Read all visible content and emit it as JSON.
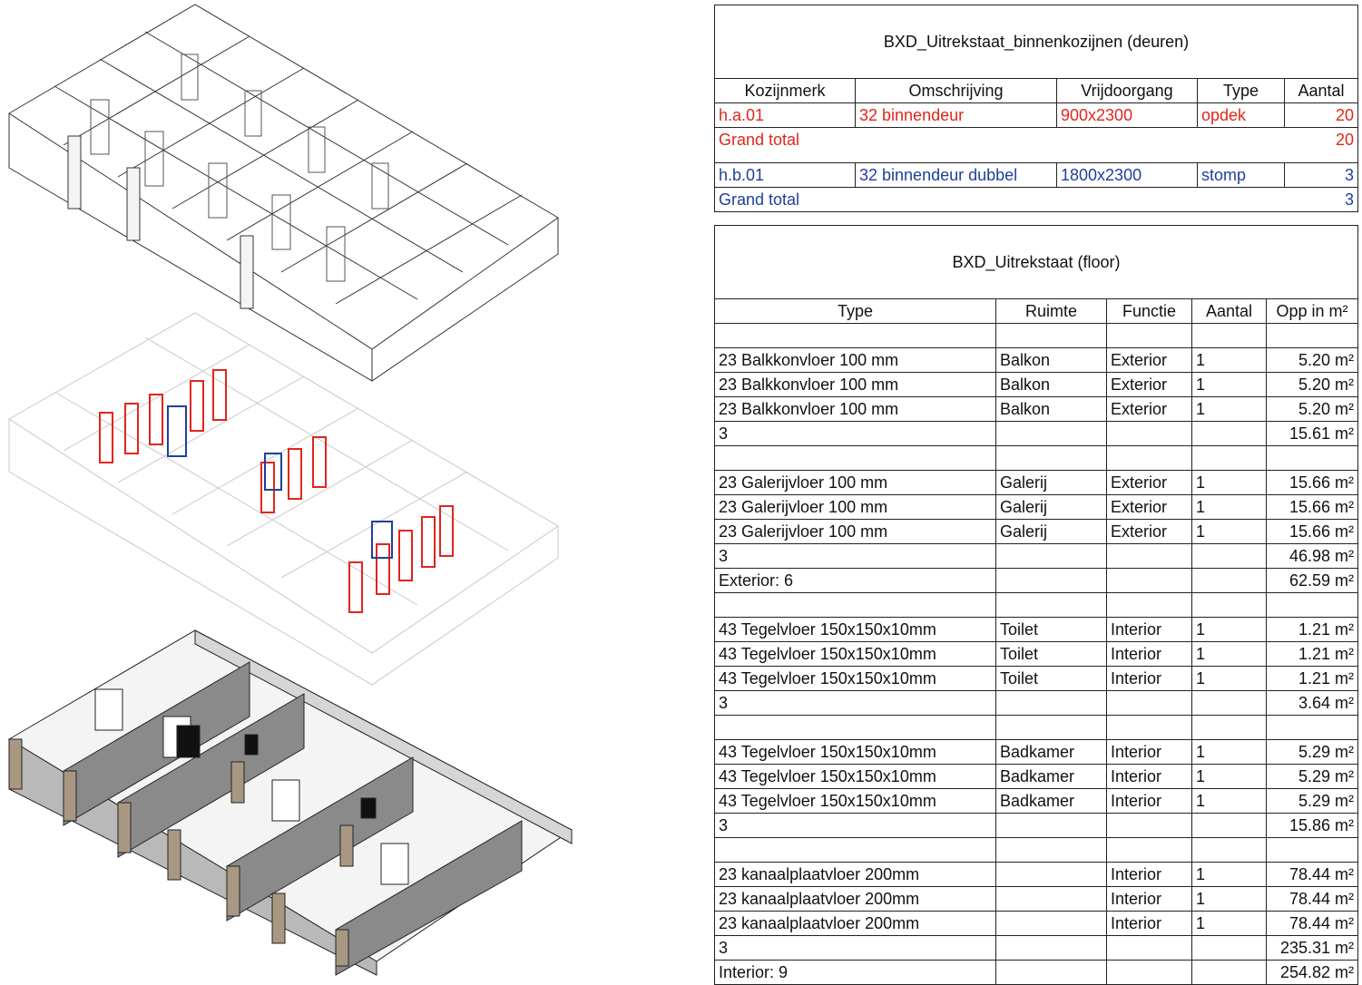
{
  "doors_schedule": {
    "title": "BXD_Uitrekstaat_binnenkozijnen (deuren)",
    "headers": [
      "Kozijnmerk",
      "Omschrijving",
      "Vrijdoorgang",
      "Type",
      "Aantal"
    ],
    "group_a": {
      "row": [
        "h.a.01",
        "32 binnendeur",
        "900x2300",
        "opdek",
        "20"
      ],
      "grand_total_label": "Grand total",
      "grand_total_value": "20"
    },
    "group_b": {
      "row": [
        "h.b.01",
        "32 binnendeur dubbel",
        "1800x2300",
        "stomp",
        "3"
      ],
      "grand_total_label": "Grand total",
      "grand_total_value": "3"
    }
  },
  "floor_schedule": {
    "title": "BXD_Uitrekstaat (floor)",
    "headers": [
      "Type",
      "Ruimte",
      "Functie",
      "Aantal",
      "Opp in m²"
    ],
    "rows": [
      [
        "",
        "",
        "",
        "",
        ""
      ],
      [
        "23 Balkkonvloer 100 mm",
        "Balkon",
        "Exterior",
        "1",
        "5.20 m²"
      ],
      [
        "23 Balkkonvloer 100 mm",
        "Balkon",
        "Exterior",
        "1",
        "5.20 m²"
      ],
      [
        "23 Balkkonvloer 100 mm",
        "Balkon",
        "Exterior",
        "1",
        "5.20 m²"
      ],
      [
        "3",
        "",
        "",
        "",
        "15.61 m²"
      ],
      [
        "",
        "",
        "",
        "",
        ""
      ],
      [
        "23 Galerijvloer 100 mm",
        "Galerij",
        "Exterior",
        "1",
        "15.66 m²"
      ],
      [
        "23 Galerijvloer 100 mm",
        "Galerij",
        "Exterior",
        "1",
        "15.66 m²"
      ],
      [
        "23 Galerijvloer 100 mm",
        "Galerij",
        "Exterior",
        "1",
        "15.66 m²"
      ],
      [
        "3",
        "",
        "",
        "",
        "46.98 m²"
      ],
      [
        "Exterior: 6",
        "",
        "",
        "",
        "62.59 m²"
      ],
      [
        "",
        "",
        "",
        "",
        ""
      ],
      [
        "43 Tegelvloer 150x150x10mm",
        "Toilet",
        "Interior",
        "1",
        "1.21 m²"
      ],
      [
        "43 Tegelvloer 150x150x10mm",
        "Toilet",
        "Interior",
        "1",
        "1.21 m²"
      ],
      [
        "43 Tegelvloer 150x150x10mm",
        "Toilet",
        "Interior",
        "1",
        "1.21 m²"
      ],
      [
        "3",
        "",
        "",
        "",
        "3.64 m²"
      ],
      [
        "",
        "",
        "",
        "",
        ""
      ],
      [
        "43 Tegelvloer 150x150x10mm",
        "Badkamer",
        "Interior",
        "1",
        "5.29 m²"
      ],
      [
        "43 Tegelvloer 150x150x10mm",
        "Badkamer",
        "Interior",
        "1",
        "5.29 m²"
      ],
      [
        "43 Tegelvloer 150x150x10mm",
        "Badkamer",
        "Interior",
        "1",
        "5.29 m²"
      ],
      [
        "3",
        "",
        "",
        "",
        "15.86 m²"
      ],
      [
        "",
        "",
        "",
        "",
        ""
      ],
      [
        "23 kanaalplaatvloer 200mm",
        "",
        "Interior",
        "1",
        "78.44 m²"
      ],
      [
        "23 kanaalplaatvloer 200mm",
        "",
        "Interior",
        "1",
        "78.44 m²"
      ],
      [
        "23 kanaalplaatvloer 200mm",
        "",
        "Interior",
        "1",
        "78.44 m²"
      ],
      [
        "3",
        "",
        "",
        "",
        "235.31 m²"
      ],
      [
        "Interior: 9",
        "",
        "",
        "",
        "254.82 m²"
      ]
    ]
  },
  "colors": {
    "door_single": "#e0261b",
    "door_double": "#1f3f9c",
    "wall_shade": "#8a8a8a",
    "wall_accent": "#a89882"
  }
}
